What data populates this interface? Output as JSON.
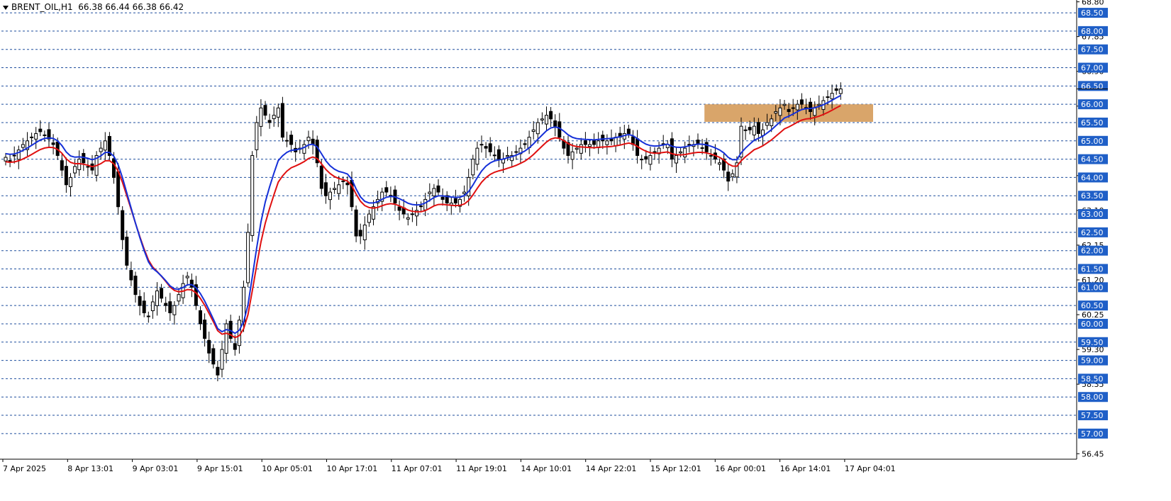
{
  "header": {
    "symbol": "BRENT_OIL,H1",
    "ohlc": "66.38 66.44 66.38 66.42"
  },
  "colors": {
    "grid": "#1f4e9e",
    "label_bg": "#1f5fc7",
    "ema_fast": "#1530d8",
    "ema_slow": "#e01010",
    "zone": "#d9a56a"
  },
  "chart_data": {
    "type": "candlestick",
    "ylim": [
      56.3,
      68.85
    ],
    "price_ticks_grid": [
      "68.50",
      "68.00",
      "67.50",
      "67.00",
      "66.50",
      "66.00",
      "65.50",
      "65.00",
      "64.50",
      "64.00",
      "63.50",
      "63.00",
      "62.50",
      "62.00",
      "61.50",
      "61.00",
      "60.50",
      "60.00",
      "59.50",
      "59.00",
      "58.50",
      "58.00",
      "57.50",
      "57.00"
    ],
    "price_ticks_plain": [
      "68.80",
      "67.85",
      "66.90",
      "65.95",
      "64.05",
      "63.10",
      "62.15",
      "61.20",
      "60.25",
      "59.30",
      "58.35",
      "56.45"
    ],
    "current_price": "66.42",
    "x_labels": [
      "7 Apr 2025",
      "8 Apr 13:01",
      "9 Apr 03:01",
      "9 Apr 15:01",
      "10 Apr 05:01",
      "10 Apr 17:01",
      "11 Apr 07:01",
      "11 Apr 19:01",
      "14 Apr 10:01",
      "14 Apr 22:01",
      "15 Apr 12:01",
      "16 Apr 00:01",
      "16 Apr 14:01",
      "17 Apr 04:01"
    ],
    "zone": {
      "bar_start": 162,
      "bar_end": 200,
      "low": 65.52,
      "high": 66.0
    },
    "close": [
      64.55,
      64.45,
      64.6,
      64.75,
      64.9,
      65.0,
      65.1,
      65.2,
      65.25,
      65.15,
      65.05,
      64.9,
      64.6,
      64.2,
      63.8,
      64.0,
      64.3,
      64.5,
      64.4,
      64.3,
      64.2,
      64.6,
      64.8,
      65.0,
      64.6,
      64.0,
      63.2,
      62.3,
      61.6,
      61.2,
      60.8,
      60.5,
      60.3,
      60.2,
      60.6,
      60.9,
      60.7,
      60.5,
      60.3,
      60.5,
      60.8,
      61.1,
      61.3,
      61.0,
      60.5,
      60.0,
      59.6,
      59.2,
      58.9,
      58.6,
      59.3,
      60.0,
      59.6,
      59.3,
      60.1,
      61.0,
      62.5,
      64.6,
      65.5,
      65.9,
      65.7,
      65.5,
      65.7,
      65.9,
      65.1,
      65.0,
      64.9,
      64.7,
      64.8,
      64.9,
      65.1,
      64.9,
      64.4,
      63.7,
      63.5,
      63.6,
      63.7,
      63.8,
      63.9,
      63.8,
      63.2,
      62.4,
      62.4,
      62.7,
      63.0,
      63.2,
      63.4,
      63.6,
      63.6,
      63.5,
      63.3,
      63.1,
      63.0,
      62.9,
      63.0,
      63.1,
      63.2,
      63.4,
      63.6,
      63.7,
      63.6,
      63.4,
      63.3,
      63.3,
      63.3,
      63.4,
      63.6,
      64.0,
      64.5,
      64.8,
      64.9,
      64.8,
      64.7,
      64.6,
      64.5,
      64.5,
      64.6,
      64.6,
      64.7,
      64.8,
      64.9,
      65.1,
      65.3,
      65.5,
      65.6,
      65.7,
      65.6,
      65.4,
      65.1,
      64.8,
      64.6,
      64.7,
      64.8,
      64.9,
      64.9,
      64.9,
      64.9,
      65.0,
      65.0,
      65.0,
      65.0,
      65.1,
      65.1,
      65.2,
      65.2,
      64.9,
      64.6,
      64.5,
      64.5,
      64.6,
      64.7,
      64.8,
      64.9,
      64.9,
      64.5,
      64.6,
      64.7,
      64.8,
      64.9,
      64.9,
      64.9,
      64.8,
      64.7,
      64.6,
      64.5,
      64.4,
      64.2,
      63.9,
      64.1,
      64.4,
      65.4,
      65.3,
      65.3,
      65.4,
      65.2,
      65.3,
      65.5,
      65.6,
      65.8,
      65.9,
      66.0,
      65.8,
      65.9,
      66.0,
      66.0,
      65.9,
      65.8,
      65.9,
      66.0,
      66.1,
      66.2,
      66.3,
      66.38,
      66.42
    ]
  }
}
